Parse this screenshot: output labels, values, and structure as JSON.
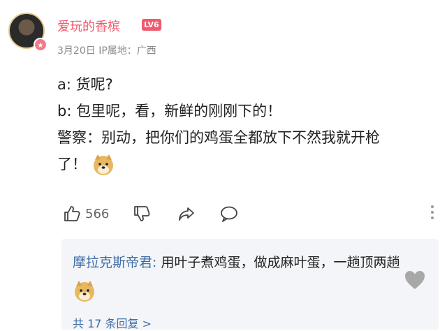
{
  "post": {
    "username": "爱玩的香槟",
    "level": "LV6",
    "date": "3月20日",
    "ip_location": "IP属地：广西",
    "lines": [
      "a: 货呢?",
      "b: 包里呢，看，新鲜的刚刚下的！",
      "警察：别动，把你们的鸡蛋全都放下不然我就开枪",
      "了！"
    ],
    "like_count": "566"
  },
  "reply": {
    "author": "摩拉克斯帝君:",
    "text": "用叶子煮鸡蛋，做成麻叶蛋，一趟顶两趟",
    "more": "共 17 条回复 >"
  },
  "icons": {
    "badge": "crown-badge-icon",
    "like": "thumbs-up-icon",
    "dislike": "thumbs-down-icon",
    "share": "share-icon",
    "comment": "comment-bubble-icon",
    "more": "more-vertical-icon",
    "heart": "heart-icon",
    "emoji": "doge-emoji"
  },
  "colors": {
    "username": "#ee5a6e",
    "reply_author": "#3d6da8",
    "reply_bg": "#f4f5f8"
  }
}
